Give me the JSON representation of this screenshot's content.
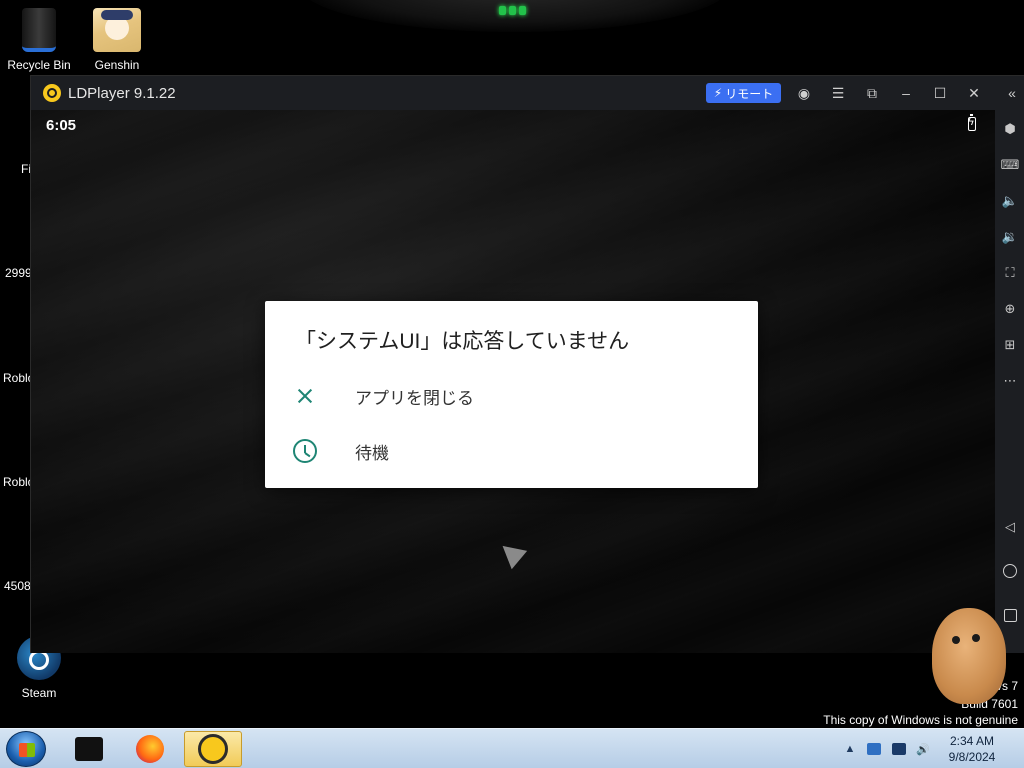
{
  "desktop": {
    "icons": {
      "recycle_bin": "Recycle Bin",
      "genshin": "Genshin",
      "steam": "Steam"
    },
    "partial_labels": [
      "Fi",
      "2999",
      "Roblo",
      "Roblo",
      "4508"
    ],
    "genuine_notice": {
      "line1": "vs 7",
      "line2": "Build 7601",
      "line3": "This copy of Windows is not genuine"
    }
  },
  "ldplayer": {
    "title": "LDPlayer 9.1.22",
    "remote_label": "リモート",
    "status_time": "6:05",
    "dialog": {
      "title": "「システムUI」は応答していません",
      "options": [
        {
          "label": "アプリを閉じる",
          "icon": "close-icon"
        },
        {
          "label": "待機",
          "icon": "clock-icon"
        }
      ]
    },
    "colors": {
      "accent": "#1e8574",
      "remote_button": "#3b6ff2",
      "titlebar": "#1c1e22"
    }
  },
  "taskbar": {
    "time": "2:34 AM",
    "date": "9/8/2024"
  }
}
